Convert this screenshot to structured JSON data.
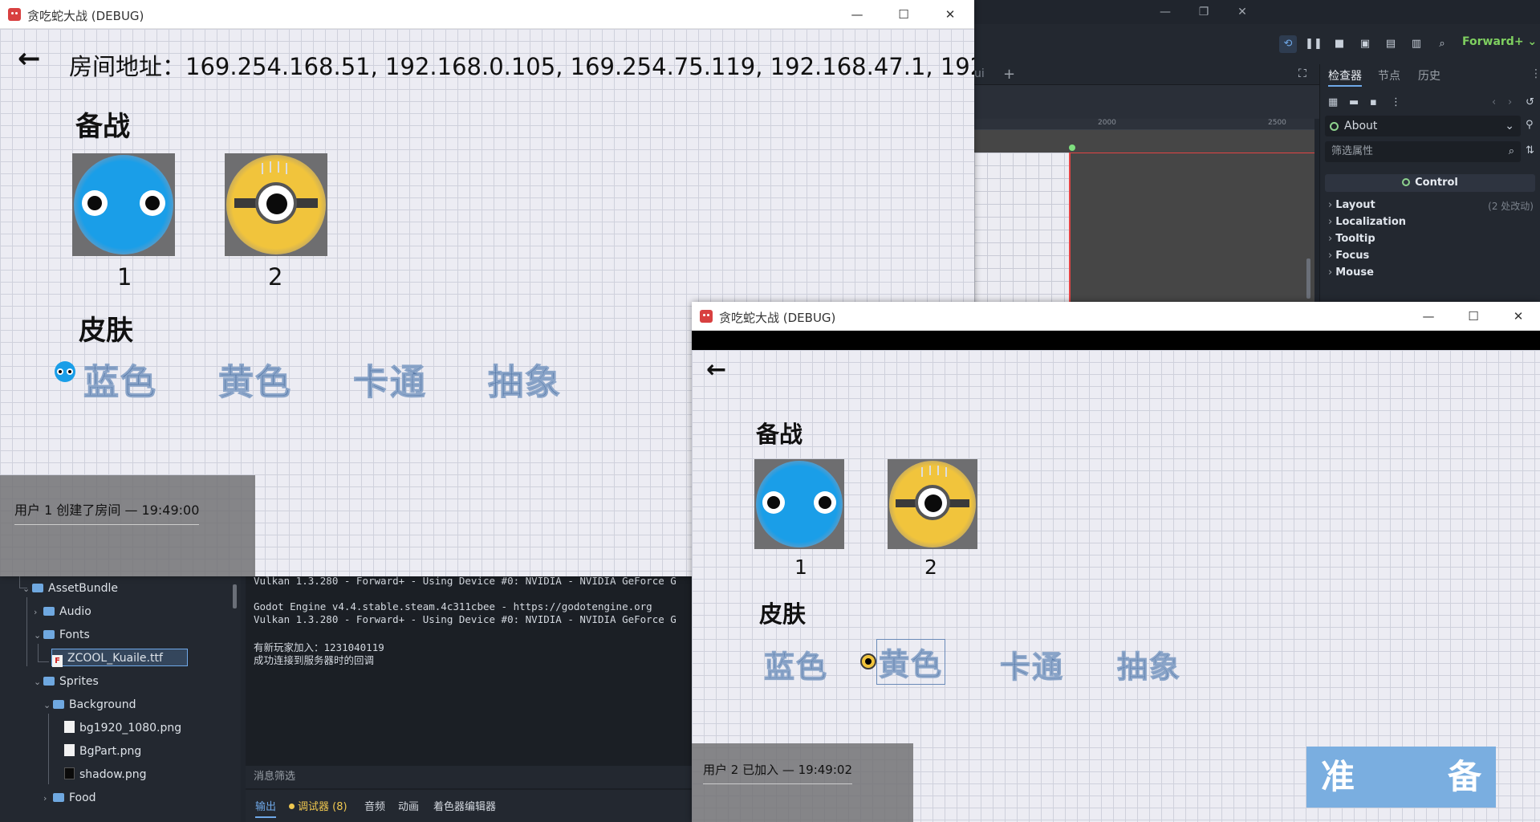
{
  "editor": {
    "window_controls": [
      "—",
      "❐",
      "✕"
    ],
    "renderer_label": "Forward+",
    "scene_tab_fragment": "ui",
    "ruler_ticks": [
      "2000",
      "2500"
    ],
    "inspector": {
      "tabs": [
        "检查器",
        "节点",
        "历史"
      ],
      "object_name": "About",
      "filter_placeholder": "筛选属性",
      "class_header": "Control",
      "sections": [
        {
          "label": "Layout",
          "note": "(2 处改动)"
        },
        {
          "label": "Localization",
          "note": ""
        },
        {
          "label": "Tooltip",
          "note": ""
        },
        {
          "label": "Focus",
          "note": ""
        },
        {
          "label": "Mouse",
          "note": ""
        }
      ]
    },
    "filesystem": {
      "items": [
        {
          "label": "AssetBundle",
          "type": "folder"
        },
        {
          "label": "Audio",
          "type": "folder"
        },
        {
          "label": "Fonts",
          "type": "folder"
        },
        {
          "label": "ZCOOL_Kuaile.ttf",
          "type": "font"
        },
        {
          "label": "Sprites",
          "type": "folder"
        },
        {
          "label": "Background",
          "type": "folder"
        },
        {
          "label": "bg1920_1080.png",
          "type": "image"
        },
        {
          "label": "BgPart.png",
          "type": "image"
        },
        {
          "label": "shadow.png",
          "type": "image-dark"
        },
        {
          "label": "Food",
          "type": "folder"
        }
      ]
    },
    "output": {
      "lines": [
        "Vulkan 1.3.280 - Forward+ - Using Device #0: NVIDIA - NVIDIA GeForce G",
        "",
        "Godot Engine v4.4.stable.steam.4c311cbee - https://godotengine.org",
        "Vulkan 1.3.280 - Forward+ - Using Device #0: NVIDIA - NVIDIA GeForce G",
        "",
        "有新玩家加入：1231040119",
        "成功连接到服务器时的回调"
      ],
      "filter_placeholder": "消息筛选",
      "tabs": [
        "输出",
        "调试器 (8)",
        "音频",
        "动画",
        "着色器编辑器"
      ]
    }
  },
  "game_window_1": {
    "title": "贪吃蛇大战 (DEBUG)",
    "back_arrow": "←",
    "room_address": "房间地址：169.254.168.51, 192.168.0.105, 169.254.75.119, 192.168.47.1, 192.",
    "ready_heading": "备战",
    "players": [
      "1",
      "2"
    ],
    "skin_heading": "皮肤",
    "skins": [
      "蓝色",
      "黄色",
      "卡通",
      "抽象"
    ],
    "selected_skin": "蓝色",
    "chat": [
      "用户 1 创建了房间 — 19:49:00"
    ]
  },
  "game_window_2": {
    "title": "贪吃蛇大战 (DEBUG)",
    "back_arrow": "←",
    "ready_heading": "备战",
    "players": [
      "1",
      "2"
    ],
    "skin_heading": "皮肤",
    "skins": [
      "蓝色",
      "黄色",
      "卡通",
      "抽象"
    ],
    "selected_skin": "黄色",
    "chat": [
      "用户 2 已加入 — 19:49:02"
    ],
    "ready_button": [
      "准",
      "备"
    ]
  },
  "colors": {
    "skin_text": "#5a7caa",
    "ready_button": "#7aaee0",
    "blue_player": "#1a9ee8",
    "yellow_player": "#f1c43c"
  }
}
